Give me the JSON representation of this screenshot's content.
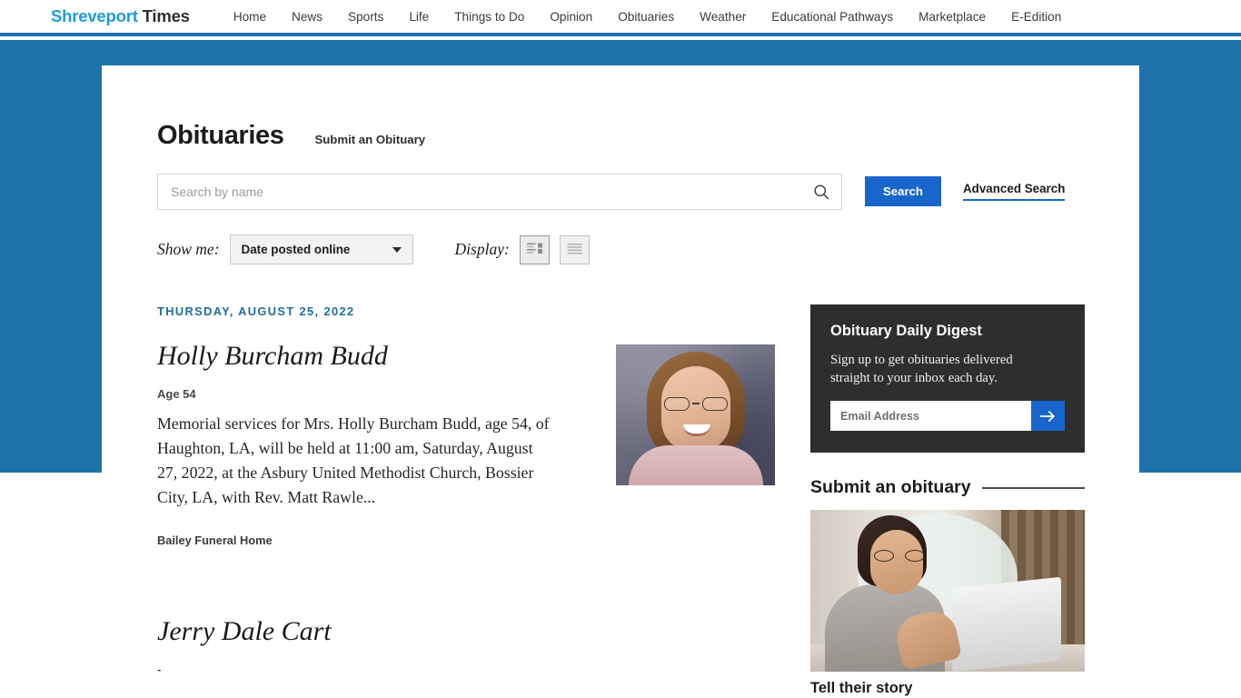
{
  "nav": {
    "brand_primary": "Shreveport",
    "brand_secondary": "Times",
    "links": [
      {
        "label": "Home"
      },
      {
        "label": "News"
      },
      {
        "label": "Sports"
      },
      {
        "label": "Life"
      },
      {
        "label": "Things to Do"
      },
      {
        "label": "Opinion"
      },
      {
        "label": "Obituaries"
      },
      {
        "label": "Weather"
      },
      {
        "label": "Educational Pathways"
      },
      {
        "label": "Marketplace"
      },
      {
        "label": "E-Edition"
      }
    ]
  },
  "header": {
    "title": "Obituaries",
    "submit_link": "Submit an Obituary"
  },
  "search": {
    "placeholder": "Search by name",
    "value": "",
    "button_label": "Search",
    "advanced_label": "Advanced Search",
    "search_icon": "search-icon"
  },
  "filters": {
    "show_me_label": "Show me:",
    "show_me_value": "Date posted online",
    "show_me_options": [
      "Date posted online"
    ],
    "display_label": "Display:",
    "display_modes": [
      {
        "name": "grid-view",
        "active": true
      },
      {
        "name": "list-view",
        "active": false
      }
    ]
  },
  "listing": {
    "date_header": "THURSDAY, AUGUST 25, 2022",
    "entries": [
      {
        "name": "Holly Burcham Budd",
        "age": "Age 54",
        "excerpt": "Memorial services for Mrs. Holly Burcham Budd, age 54, of Haughton, LA, will be held at 11:00 am, Saturday, August 27, 2022, at the Asbury United Methodist Church, Bossier City, LA, with Rev. Matt Rawle...",
        "funeral_home": "Bailey Funeral Home",
        "has_photo": true
      },
      {
        "name": "Jerry Dale Cart",
        "age": "-",
        "excerpt": "",
        "funeral_home": "",
        "has_photo": false
      }
    ]
  },
  "sidebar": {
    "digest": {
      "title": "Obituary Daily Digest",
      "subtitle": "Sign up to get obituaries delivered straight to your inbox each day.",
      "email_placeholder": "Email Address",
      "email_value": "",
      "submit_icon": "arrow-right-icon"
    },
    "submit_section": {
      "heading": "Submit an obituary",
      "caption": "Tell their story"
    }
  },
  "colors": {
    "brand_blue": "#1b9ce3",
    "band_blue": "#1e72ab",
    "accent_blue": "#1866cc",
    "date_blue": "#1f6c9e",
    "digest_bg": "#2e2e2e"
  }
}
